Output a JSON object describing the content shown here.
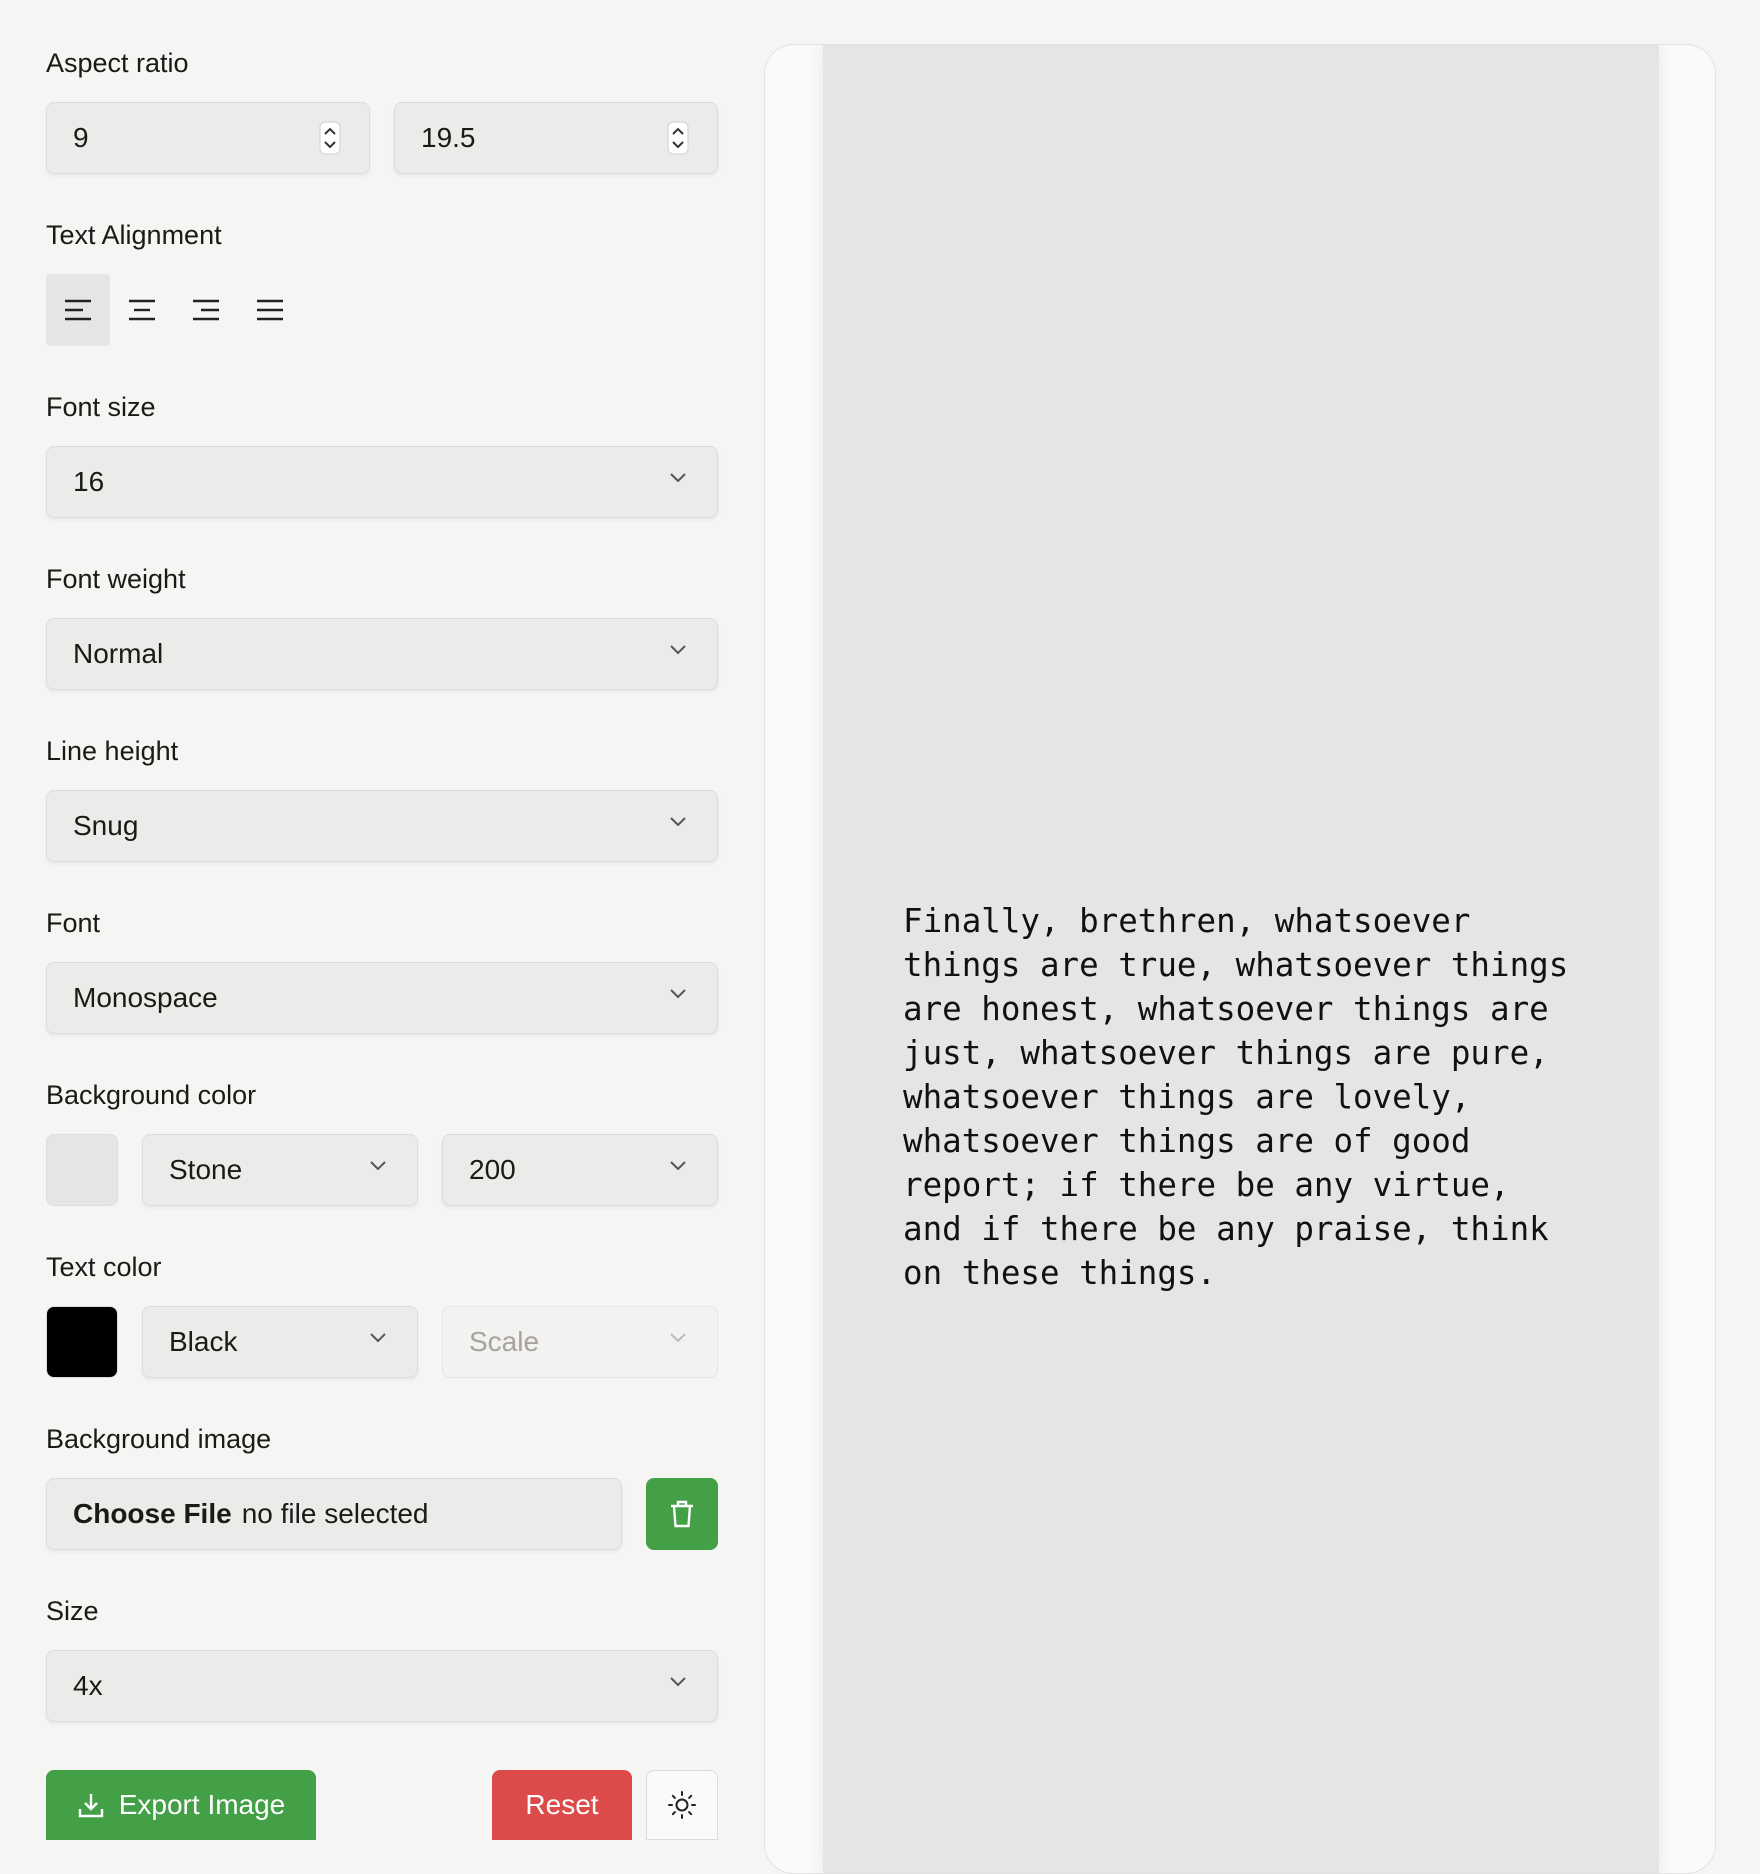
{
  "aspect_ratio": {
    "label": "Aspect ratio",
    "width_value": "9",
    "height_value": "19.5"
  },
  "text_alignment": {
    "label": "Text Alignment",
    "options": [
      "align-left",
      "align-center",
      "align-right",
      "align-justify"
    ],
    "selected": "align-left"
  },
  "font_size": {
    "label": "Font size",
    "value": "16"
  },
  "font_weight": {
    "label": "Font weight",
    "value": "Normal"
  },
  "line_height": {
    "label": "Line height",
    "value": "Snug"
  },
  "font": {
    "label": "Font",
    "value": "Monospace"
  },
  "background_color": {
    "label": "Background color",
    "swatch": "#e7e5e4",
    "family": "Stone",
    "shade": "200"
  },
  "text_color": {
    "label": "Text color",
    "swatch": "#000000",
    "family": "Black",
    "shade_placeholder": "Scale"
  },
  "background_image": {
    "label": "Background image",
    "choose_label": "Choose File",
    "status": "no file selected"
  },
  "size": {
    "label": "Size",
    "value": "4x"
  },
  "actions": {
    "export_label": "Export Image",
    "reset_label": "Reset"
  },
  "colors": {
    "green": "#43a047",
    "red": "#dc4a4a",
    "canvas_bg": "#e7e5e4"
  },
  "preview": {
    "text": "Finally, brethren, whatsoever\nthings are true, whatsoever things\nare honest, whatsoever things are\njust, whatsoever things are pure,\nwhatsoever things are lovely,\nwhatsoever things are of good\nreport; if there be any virtue,\nand if there be any praise, think\non these things."
  }
}
